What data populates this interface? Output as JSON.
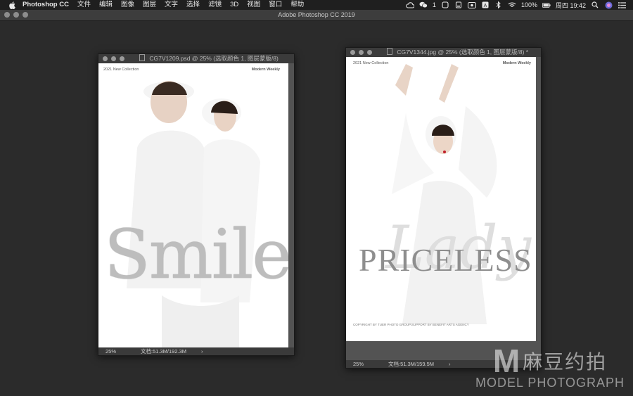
{
  "menubar": {
    "app_name": "Photoshop CC",
    "items": [
      "文件",
      "编辑",
      "图像",
      "图层",
      "文字",
      "选择",
      "滤镜",
      "3D",
      "视图",
      "窗口",
      "帮助"
    ],
    "status": {
      "wechat_count": "1",
      "battery": "100%",
      "clock": "周四 19:42"
    }
  },
  "window": {
    "title": "Adobe Photoshop CC 2019"
  },
  "doc1": {
    "title": "CG7V1209.psd @ 25% (选取颜色 1, 图层蒙版/8)",
    "zoom": "25%",
    "docsize": "文档:51.3M/192.3M",
    "collection": "2021 New Collection",
    "brand": "Modern Weekly",
    "headline": "Smile"
  },
  "doc2": {
    "title": "CG7V1344.jpg @ 25% (选取颜色 1, 图层蒙版/8) *",
    "zoom": "25%",
    "docsize": "文档:51.3M/159.5M",
    "collection": "2021 New Collection",
    "brand": "Modern Weekly",
    "headline": "PRICELESS",
    "script": "Lady",
    "copyright": "COPYRIGHT BY TUER PHOTO GROUP.SUPPORT BY BENEFIT ARTS AGENCY"
  },
  "watermark": {
    "cn": "麻豆约拍",
    "en": "MODEL PHOTOGRAPH"
  }
}
